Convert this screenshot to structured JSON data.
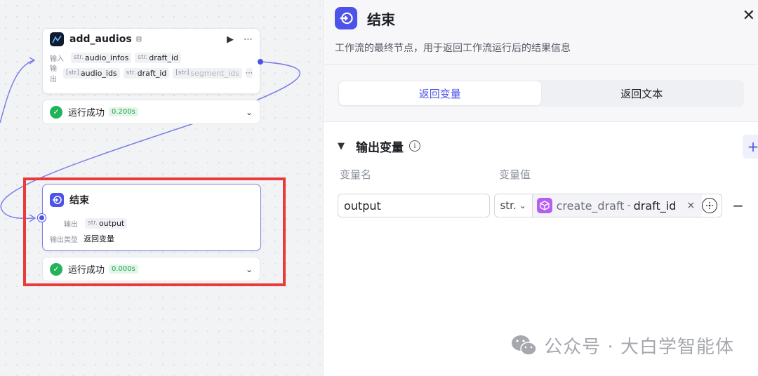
{
  "canvas": {
    "audio_node": {
      "title": "add_audios",
      "title_extra_icon": "cube-icon",
      "run_icon": "play-icon",
      "more": "⋯",
      "input_label": "输入",
      "inputs": [
        {
          "type": "str.",
          "name": "audio_infos"
        },
        {
          "type": "str.",
          "name": "draft_id"
        }
      ],
      "output_label": "输出",
      "outputs": [
        {
          "type": "[str]",
          "name": "audio_ids"
        },
        {
          "type": "str.",
          "name": "draft_id"
        },
        {
          "type": "[str]",
          "name": "segment_ids"
        }
      ],
      "outputs_more": "⋯",
      "status": {
        "text": "运行成功",
        "duration": "0.200s"
      }
    },
    "end_node": {
      "title": "结束",
      "output_label": "输出",
      "output": {
        "type": "str.",
        "name": "output"
      },
      "output_type_label": "输出类型",
      "output_type_value": "返回变量",
      "status": {
        "text": "运行成功",
        "duration": "0.000s"
      }
    }
  },
  "panel": {
    "title": "结束",
    "description": "工作流的最终节点，用于返回工作流运行后的结果信息",
    "close": "✕",
    "tabs": [
      {
        "label": "返回变量",
        "active": true
      },
      {
        "label": "返回文本",
        "active": false
      }
    ],
    "section": {
      "title": "输出变量",
      "info": "i",
      "add": "+",
      "col_name": "变量名",
      "col_value": "变量值",
      "rows": [
        {
          "name": "output",
          "type": "str.",
          "ref_node": "create_draft",
          "ref_sep": "-",
          "ref_field": "draft_id",
          "clear": "×",
          "remove": "−"
        }
      ]
    }
  },
  "watermark": "公众号 · 大白学智能体",
  "colors": {
    "accent": "#4d53e8",
    "success": "#21b35a",
    "highlight_box": "#ea3b3b",
    "ref_icon": "#b45ff0"
  }
}
